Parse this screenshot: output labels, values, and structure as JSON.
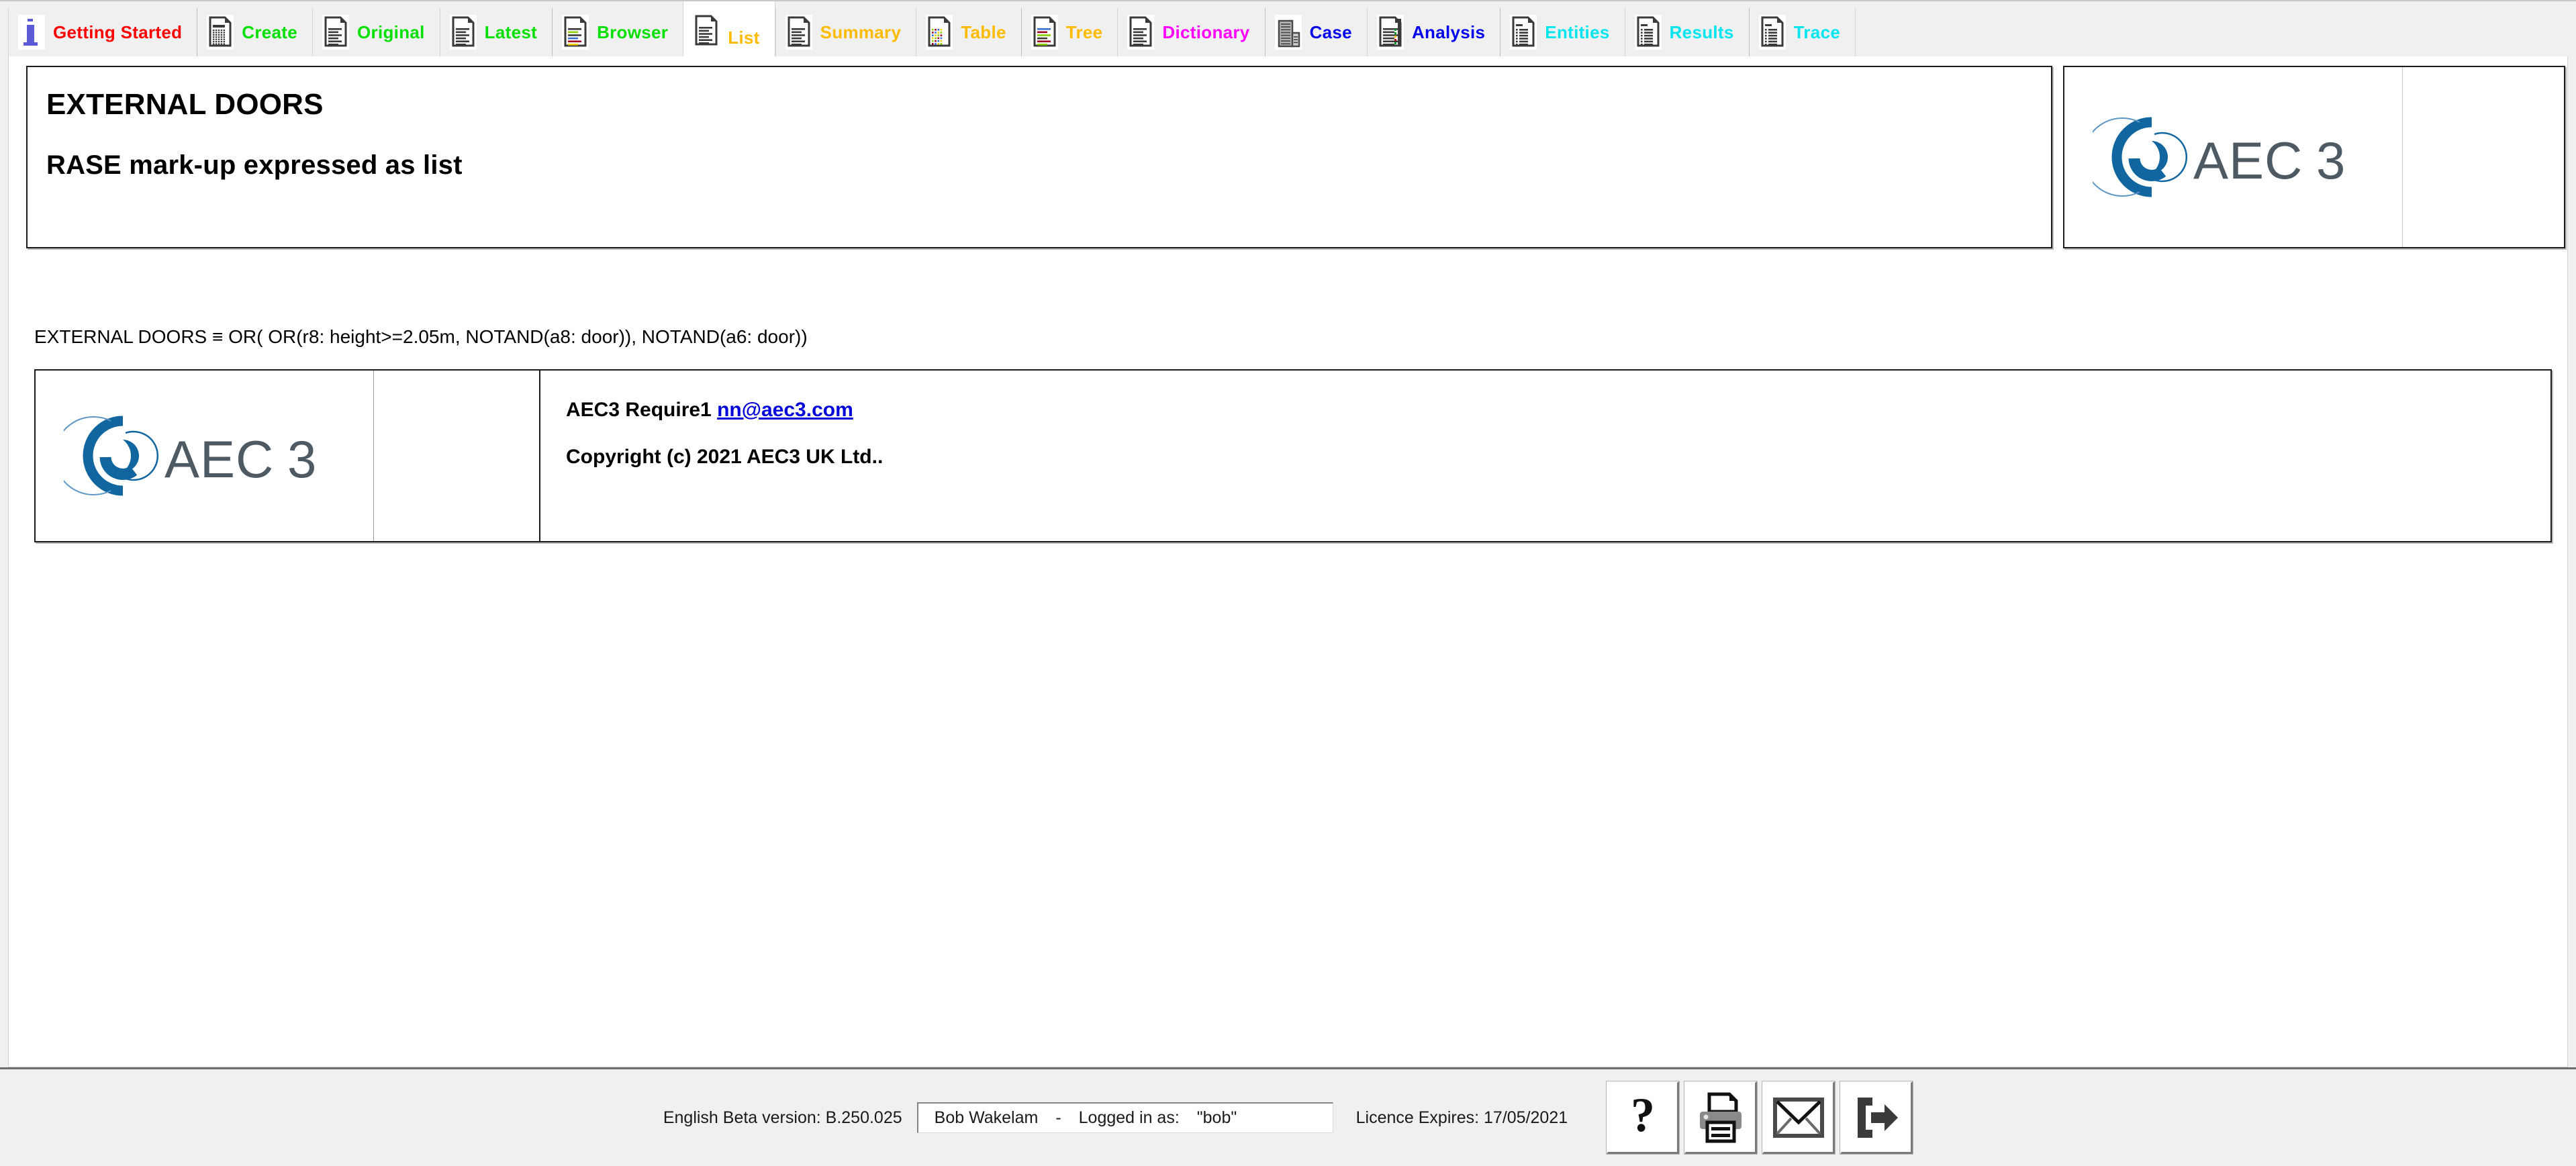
{
  "tabbar": {
    "tabs": [
      {
        "label": "Getting Started",
        "color": "#ff0000",
        "icon": "info-document-icon",
        "icon_kind": "info",
        "active": false,
        "group_start": false
      },
      {
        "label": "Create",
        "color": "#00e000",
        "icon": "grid-document-icon",
        "icon_kind": "grid",
        "active": false,
        "group_start": true
      },
      {
        "label": "Original",
        "color": "#00e000",
        "icon": "text-document-icon",
        "icon_kind": "lines",
        "active": false,
        "group_start": false
      },
      {
        "label": "Latest",
        "color": "#00e000",
        "icon": "text-document-icon",
        "icon_kind": "lines",
        "active": false,
        "group_start": false
      },
      {
        "label": "Browser",
        "color": "#00e000",
        "icon": "colored-lines-document-icon",
        "icon_kind": "color-lines",
        "active": false,
        "group_start": true
      },
      {
        "label": "List",
        "color": "#ffbb00",
        "icon": "list-document-icon",
        "icon_kind": "lines",
        "active": true,
        "group_start": false
      },
      {
        "label": "Summary",
        "color": "#ffbb00",
        "icon": "summary-document-icon",
        "icon_kind": "lines",
        "active": false,
        "group_start": false
      },
      {
        "label": "Table",
        "color": "#ffbb00",
        "icon": "grid-dots-document-icon",
        "icon_kind": "dots",
        "active": false,
        "group_start": false
      },
      {
        "label": "Tree",
        "color": "#ffbb00",
        "icon": "tree-document-icon",
        "icon_kind": "tree",
        "active": false,
        "group_start": true
      },
      {
        "label": "Dictionary",
        "color": "#ff00ff",
        "icon": "dictionary-document-icon",
        "icon_kind": "lines",
        "active": false,
        "group_start": false
      },
      {
        "label": "Case",
        "color": "#0000ee",
        "icon": "building-icon",
        "icon_kind": "building",
        "active": false,
        "group_start": true
      },
      {
        "label": "Analysis",
        "color": "#0000ee",
        "icon": "analysis-document-icon",
        "icon_kind": "dotlines",
        "active": false,
        "group_start": false
      },
      {
        "label": "Entities",
        "color": "#00e5ee",
        "icon": "entities-document-icon",
        "icon_kind": "bullets",
        "active": false,
        "group_start": true
      },
      {
        "label": "Results",
        "color": "#00e5ee",
        "icon": "results-document-icon",
        "icon_kind": "bullets",
        "active": false,
        "group_start": false
      },
      {
        "label": "Trace",
        "color": "#00e5ee",
        "icon": "trace-document-icon",
        "icon_kind": "bullets",
        "active": false,
        "group_start": true
      }
    ]
  },
  "header": {
    "title": "EXTERNAL DOORS",
    "subtitle": "RASE mark-up expressed as list",
    "logo_alt": "AEC3",
    "logo_wordmark": "AEC3",
    "logo_blue": "#11669f",
    "logo_gray": "#4e5a63"
  },
  "main": {
    "formula": "EXTERNAL DOORS ≡ OR( OR(r8: height>=2.05m, NOTAND(a8: door)), NOTAND(a6: door))"
  },
  "footer_card": {
    "product_line": "AEC3 Require1",
    "email": "nn@aec3.com",
    "copyright": "Copyright (c) 2021 AEC3 UK Ltd..",
    "logo_wordmark": "AEC3"
  },
  "statusbar": {
    "version": "English Beta version: B.250.025",
    "user_name": "Bob Wakelam",
    "user_separator": "-",
    "logged_in_label": "Logged in as:",
    "logged_in_user": "\"bob\"",
    "licence": "Licence Expires: 17/05/2021",
    "buttons": [
      {
        "name": "help-button",
        "icon": "question-mark-icon"
      },
      {
        "name": "print-button",
        "icon": "printer-icon"
      },
      {
        "name": "mail-button",
        "icon": "envelope-icon"
      },
      {
        "name": "exit-button",
        "icon": "exit-arrow-icon"
      }
    ]
  }
}
